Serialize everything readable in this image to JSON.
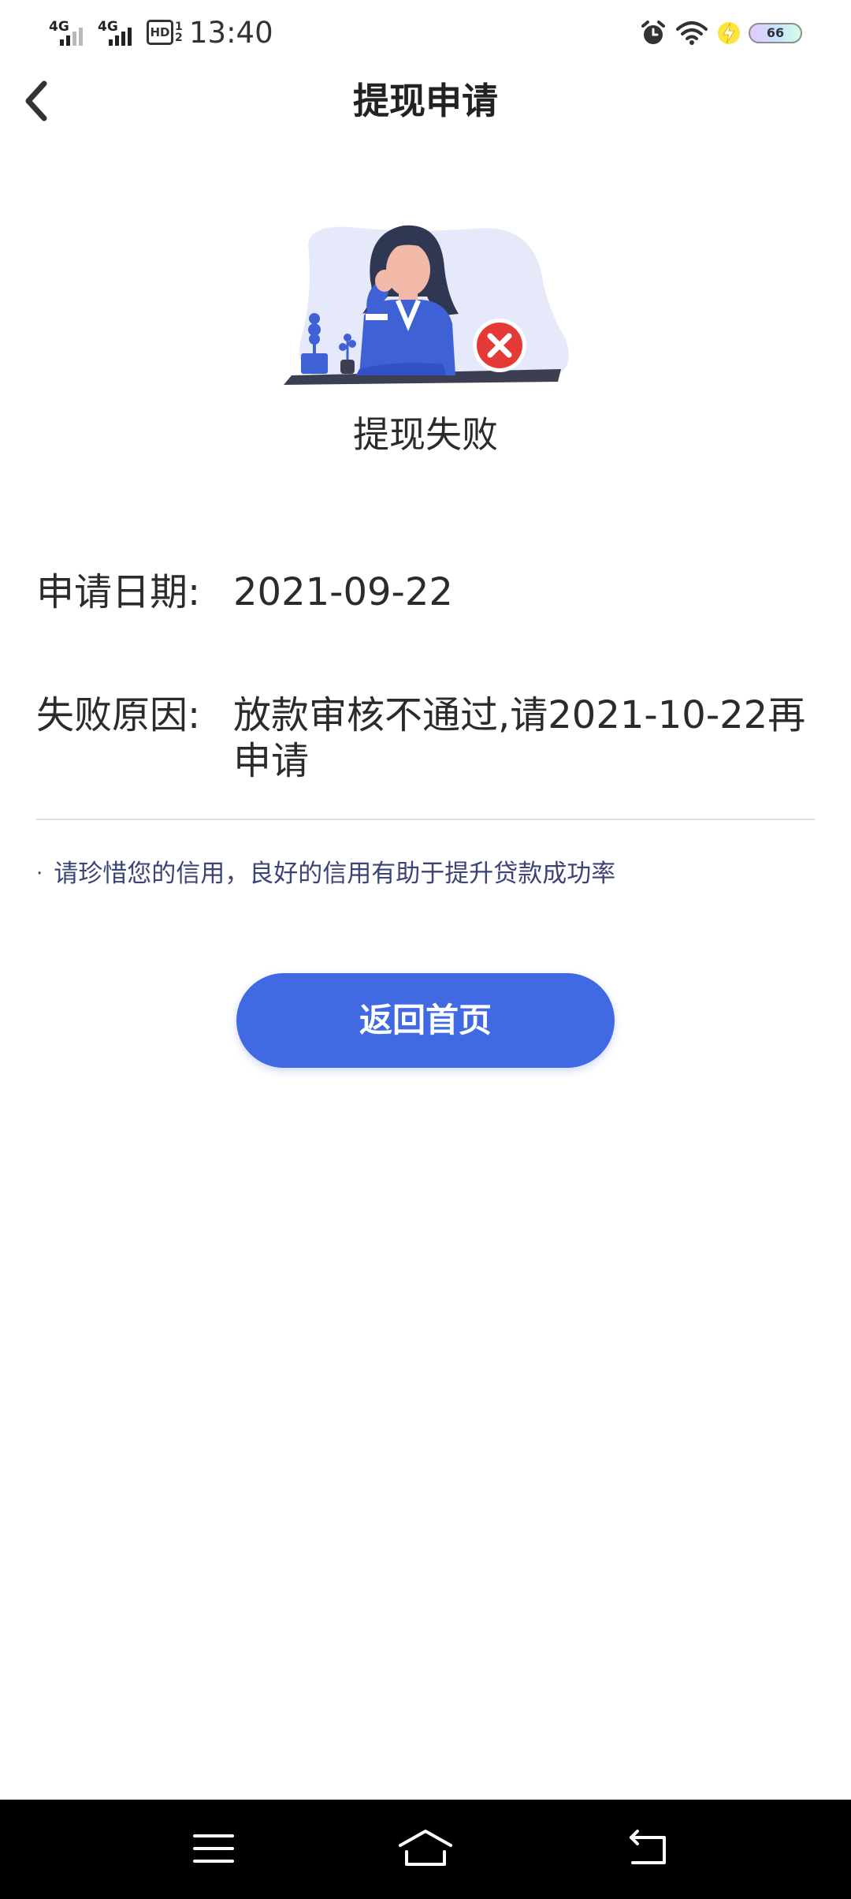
{
  "status_bar": {
    "sim1_network": "4G",
    "sim2_network": "4G",
    "hd_label": "HD",
    "hd_sub": "1 2",
    "time": "13:40",
    "battery_level": "66",
    "icons": [
      "alarm-icon",
      "wifi-icon",
      "charging-icon",
      "battery-icon"
    ]
  },
  "header": {
    "title": "提现申请",
    "back_icon": "chevron-left-icon"
  },
  "result": {
    "status_text": "提现失败",
    "illustration": "woman-at-desk-failure-illustration",
    "status_color": "#e53935"
  },
  "details": {
    "date_label": "申请日期:",
    "date_value": "2021-09-22",
    "reason_label": "失败原因:",
    "reason_value": "放款审核不通过,请2021-10-22再申请"
  },
  "tip": {
    "text": "请珍惜您的信用，良好的信用有助于提升贷款成功率"
  },
  "actions": {
    "home_button_label": "返回首页",
    "accent_color": "#4169e1"
  },
  "nav_bar": {
    "icons": [
      "menu-icon",
      "home-icon",
      "back-icon"
    ]
  }
}
